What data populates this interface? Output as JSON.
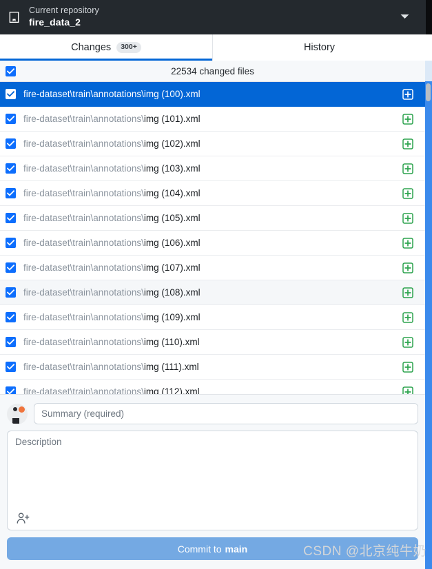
{
  "toolbar": {
    "repo_label": "Current repository",
    "repo_name": "fire_data_2",
    "repo_icon": "repo-icon",
    "dropdown_icon": "chevron-down-icon"
  },
  "tabs": [
    {
      "label": "Changes",
      "badge": "300+",
      "active": true
    },
    {
      "label": "History",
      "badge": "",
      "active": false
    }
  ],
  "files_header": {
    "title": "22534 changed files",
    "select_all_checked": true
  },
  "files": [
    {
      "path": "fire-dataset\\train\\annotations\\",
      "name": "img (100).xml",
      "checked": true,
      "status": "added",
      "selected": true,
      "hover": false
    },
    {
      "path": "fire-dataset\\train\\annotations\\",
      "name": "img (101).xml",
      "checked": true,
      "status": "added",
      "selected": false,
      "hover": false
    },
    {
      "path": "fire-dataset\\train\\annotations\\",
      "name": "img (102).xml",
      "checked": true,
      "status": "added",
      "selected": false,
      "hover": false
    },
    {
      "path": "fire-dataset\\train\\annotations\\",
      "name": "img (103).xml",
      "checked": true,
      "status": "added",
      "selected": false,
      "hover": false
    },
    {
      "path": "fire-dataset\\train\\annotations\\",
      "name": "img (104).xml",
      "checked": true,
      "status": "added",
      "selected": false,
      "hover": false
    },
    {
      "path": "fire-dataset\\train\\annotations\\",
      "name": "img (105).xml",
      "checked": true,
      "status": "added",
      "selected": false,
      "hover": false
    },
    {
      "path": "fire-dataset\\train\\annotations\\",
      "name": "img (106).xml",
      "checked": true,
      "status": "added",
      "selected": false,
      "hover": false
    },
    {
      "path": "fire-dataset\\train\\annotations\\",
      "name": "img (107).xml",
      "checked": true,
      "status": "added",
      "selected": false,
      "hover": false
    },
    {
      "path": "fire-dataset\\train\\annotations\\",
      "name": "img (108).xml",
      "checked": true,
      "status": "added",
      "selected": false,
      "hover": true
    },
    {
      "path": "fire-dataset\\train\\annotations\\",
      "name": "img (109).xml",
      "checked": true,
      "status": "added",
      "selected": false,
      "hover": false
    },
    {
      "path": "fire-dataset\\train\\annotations\\",
      "name": "img (110).xml",
      "checked": true,
      "status": "added",
      "selected": false,
      "hover": false
    },
    {
      "path": "fire-dataset\\train\\annotations\\",
      "name": "img (111).xml",
      "checked": true,
      "status": "added",
      "selected": false,
      "hover": false
    },
    {
      "path": "fire-dataset\\train\\annotations\\",
      "name": "img (112).xml",
      "checked": true,
      "status": "added",
      "selected": false,
      "hover": false
    }
  ],
  "commit": {
    "summary_placeholder": "Summary (required)",
    "summary_value": "",
    "description_placeholder": "Description",
    "description_value": "",
    "coauthor_icon": "add-person-icon",
    "avatar_icon": "user-avatar",
    "button_prefix": "Commit to",
    "button_branch": "main"
  },
  "watermark": "CSDN @北京纯牛奶",
  "colors": {
    "toolbar_bg": "#24292e",
    "accent_blue": "#0366d6",
    "selected_row": "#0366d6",
    "added_green": "#2da44e",
    "checkbox_blue": "#0d6efd",
    "commit_button": "#74a9e3",
    "window_edge": "#3b8aec"
  }
}
